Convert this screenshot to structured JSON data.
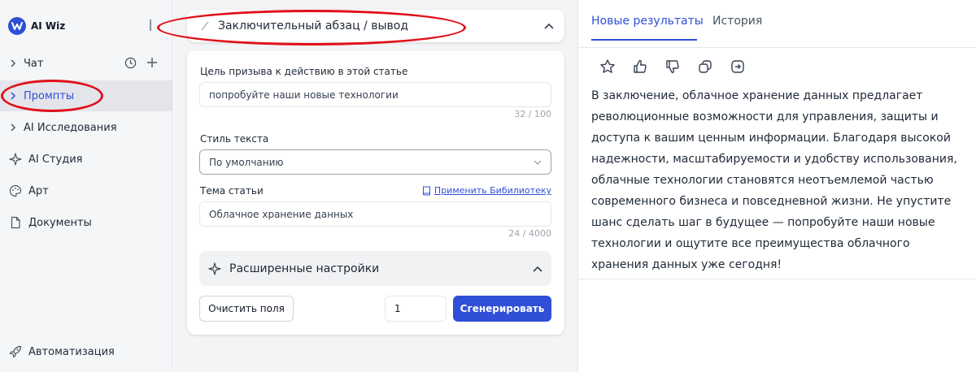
{
  "app": {
    "name": "AI Wiz"
  },
  "sidebar": {
    "items": [
      {
        "label": "Чат",
        "icon": "chevron-right-icon"
      },
      {
        "label": "Промпты",
        "icon": "chevron-right-icon"
      },
      {
        "label": "AI Исследования",
        "icon": "chevron-right-icon"
      },
      {
        "label": "AI Студия",
        "icon": "sparkle-icon"
      },
      {
        "label": "Арт",
        "icon": "palette-icon"
      },
      {
        "label": "Документы",
        "icon": "document-icon"
      }
    ],
    "bottom": {
      "label": "Автоматизация",
      "icon": "rocket-icon"
    }
  },
  "form": {
    "section_title": "Заключительный абзац / вывод",
    "cta": {
      "label": "Цель призыва к действию в этой статье",
      "value": "попробуйте наши новые технологии",
      "counter": "32 / 100"
    },
    "style": {
      "label": "Стиль текста",
      "value": "По умолчанию"
    },
    "topic": {
      "label": "Тема статьи",
      "value": "Облачное хранение данных",
      "counter": "24 / 4000",
      "library_link": "Применить Бибилиотеку"
    },
    "advanced": {
      "title": "Расширенные настройки"
    },
    "clear_button": "Очистить поля",
    "quantity": "1",
    "generate_button": "Сгенерировать"
  },
  "results": {
    "tabs": [
      "Новые результаты",
      "История"
    ],
    "active_tab": 0,
    "text": "В заключение, облачное хранение данных предлагает революционные возможности для управления, защиты и доступа к вашим ценным информации. Благодаря высокой надежности, масштабируемости и удобству использования, облачные технологии становятся неотъемлемой частью современного бизнеса и повседневной жизни. Не упустите шанс сделать шаг в будущее — попробуйте наши новые технологии и ощутите все преимущества облачного хранения данных уже сегодня!"
  },
  "colors": {
    "accent": "#2f4fd6",
    "annotation": "#e0101a",
    "sidebar_bg": "#f5f6f8",
    "active_item_bg": "#e3e5ea"
  }
}
